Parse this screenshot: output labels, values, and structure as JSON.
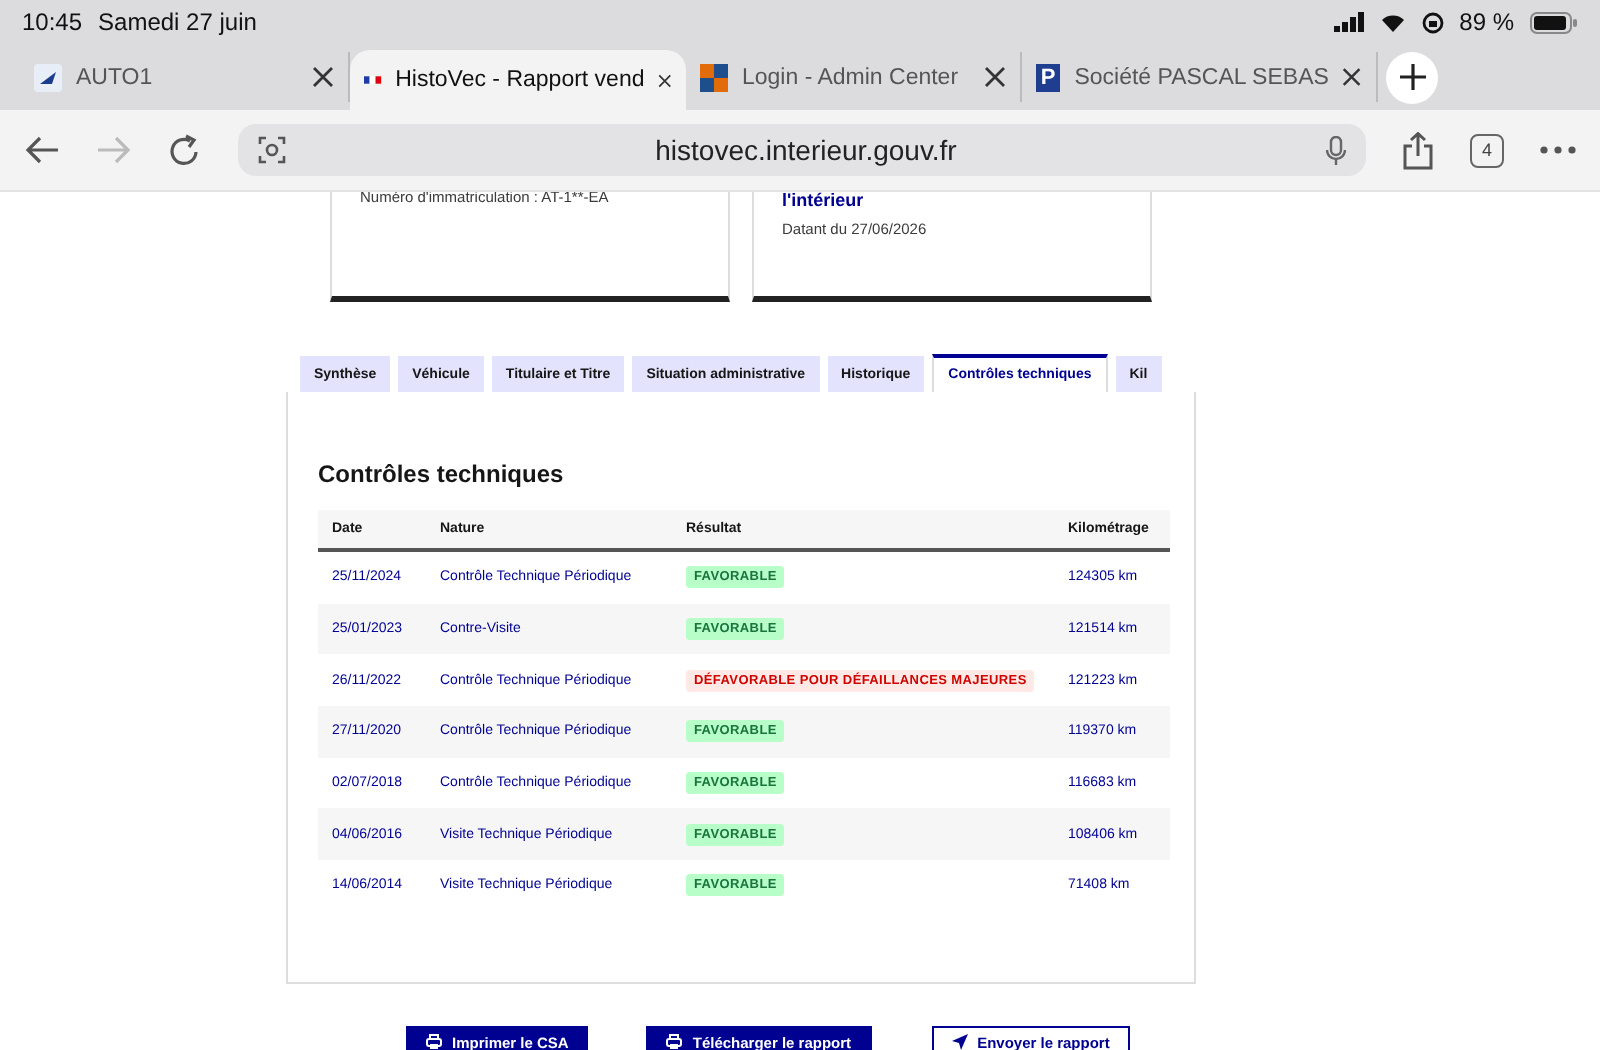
{
  "status_bar": {
    "time": "10:45",
    "date": "Samedi 27 juin",
    "battery": "89 %"
  },
  "browser_tabs": [
    {
      "title": "AUTO1",
      "selected": false,
      "kind": "auto"
    },
    {
      "title": "HistoVec - Rapport vend",
      "selected": true,
      "kind": "flag"
    },
    {
      "title": "Login - Admin Center",
      "selected": false,
      "kind": "squares"
    },
    {
      "title": "Société PASCAL SEBAS",
      "selected": false,
      "kind": "letter",
      "icon_letter": "P"
    }
  ],
  "toolbar": {
    "url": "histovec.interieur.gouv.fr",
    "tab_count": "4",
    "forward_disabled": true
  },
  "cards": [
    {
      "lines": [
        "Numéro d'immatriculation : AT-1**-EA"
      ]
    },
    {
      "heading": "l'intérieur",
      "lines": [
        "Datant du 27/06/2026"
      ]
    }
  ],
  "report_tabs": [
    {
      "label": "Synthèse",
      "selected": false
    },
    {
      "label": "Véhicule",
      "selected": false
    },
    {
      "label": "Titulaire et Titre",
      "selected": false
    },
    {
      "label": "Situation administrative",
      "selected": false
    },
    {
      "label": "Historique",
      "selected": false
    },
    {
      "label": "Contrôles techniques",
      "selected": true
    },
    {
      "label": "Kil",
      "selected": false
    }
  ],
  "section": {
    "title": "Contrôles techniques",
    "table": {
      "columns": [
        "Date",
        "Nature",
        "Résultat",
        "Kilométrage"
      ],
      "rows": [
        {
          "date": "25/11/2024",
          "nature": "Contrôle Technique Périodique",
          "result": "FAVORABLE",
          "favorable": true,
          "mileage": "124305 km"
        },
        {
          "date": "25/01/2023",
          "nature": "Contre-Visite",
          "result": "FAVORABLE",
          "favorable": true,
          "mileage": "121514 km"
        },
        {
          "date": "26/11/2022",
          "nature": "Contrôle Technique Périodique",
          "result": "DÉFAVORABLE POUR DÉFAILLANCES MAJEURES",
          "favorable": false,
          "mileage": "121223 km"
        },
        {
          "date": "27/11/2020",
          "nature": "Contrôle Technique Périodique",
          "result": "FAVORABLE",
          "favorable": true,
          "mileage": "119370 km"
        },
        {
          "date": "02/07/2018",
          "nature": "Contrôle Technique Périodique",
          "result": "FAVORABLE",
          "favorable": true,
          "mileage": "116683 km"
        },
        {
          "date": "04/06/2016",
          "nature": "Visite Technique Périodique",
          "result": "FAVORABLE",
          "favorable": true,
          "mileage": "108406 km"
        },
        {
          "date": "14/06/2014",
          "nature": "Visite Technique Périodique",
          "result": "FAVORABLE",
          "favorable": true,
          "mileage": "71408 km"
        }
      ]
    }
  },
  "actions": [
    {
      "label": "Imprimer le CSA",
      "kind": "primary"
    },
    {
      "label": "Télécharger le rapport",
      "kind": "primary"
    },
    {
      "label": "Envoyer le rapport",
      "kind": "secondary"
    }
  ]
}
